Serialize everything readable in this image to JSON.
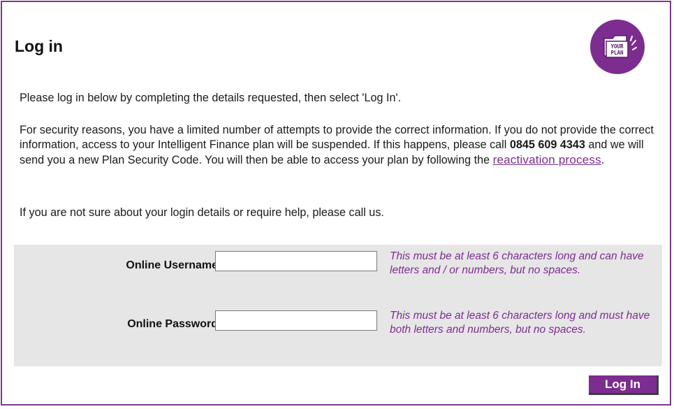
{
  "page": {
    "title": "Log in"
  },
  "logo": {
    "text_line1": "YOUR",
    "text_line2": "PLAN",
    "color": "#7c2d8f"
  },
  "intro": {
    "line1": "Please log in below by completing the details requested, then select 'Log In'.",
    "security_before_phone": "For security reasons, you have a limited number of attempts to provide the correct information. If you do not provide the correct information, access to your Intelligent Finance plan will be suspended. If this happens, please call ",
    "phone": "0845 609 4343",
    "security_after_phone": " and we will send you a new Plan Security Code. You will then be able to access your plan by following the ",
    "reactivation_link": "reactivation process",
    "period": ".",
    "help": "If you are not sure about your login details or require help, please call us."
  },
  "form": {
    "username_label": "Online Username",
    "username_value": "",
    "username_hint": "This must be at least 6 characters long and can have letters and / or numbers, but no spaces.",
    "password_label": "Online Password",
    "password_value": "",
    "password_hint": "This must be at least 6 characters long and must have both letters and numbers, but no spaces."
  },
  "actions": {
    "login_label": "Log In"
  },
  "colors": {
    "accent": "#7c2d8f",
    "form_background": "#e6e6e6"
  }
}
